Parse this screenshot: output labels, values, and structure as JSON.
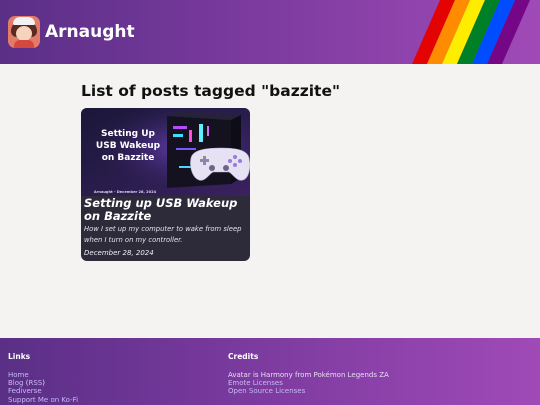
{
  "header": {
    "site_title": "Arnaught",
    "avatar_icon": "avatar-icon",
    "rainbow_colors": [
      "#e40303",
      "#ff8c00",
      "#ffed00",
      "#008026",
      "#004dff",
      "#750787"
    ]
  },
  "main": {
    "page_title": "List of posts tagged \"bazzite\""
  },
  "posts": [
    {
      "image": {
        "line1": "Setting Up",
        "line2": "USB Wakeup",
        "line3": "on Bazzite",
        "byline": "Arnaught - December 28, 2024"
      },
      "title": "Setting up USB Wakeup on Bazzite",
      "description": "How I set up my computer to wake from sleep when I turn on my controller.",
      "date": "December 28, 2024"
    }
  ],
  "footer": {
    "links_heading": "Links",
    "home": "Home",
    "blog": "Blog",
    "open_paren": " (",
    "rss": "RSS",
    "close_paren": ")",
    "fediverse": "Fediverse",
    "kofi": "Support Me on Ko-Fi",
    "credits_heading": "Credits",
    "avatar_credit": "Avatar is Harmony from Pokémon Legends ZA",
    "emote_licenses": "Emote Licenses",
    "open_source_licenses": "Open Source Licenses"
  },
  "colors": {
    "header_start": "#5a2f86",
    "header_end": "#a04ab7",
    "page_background": "#f4f3f1",
    "card_background": "#2d2b3a",
    "link": "#c7baf5"
  }
}
